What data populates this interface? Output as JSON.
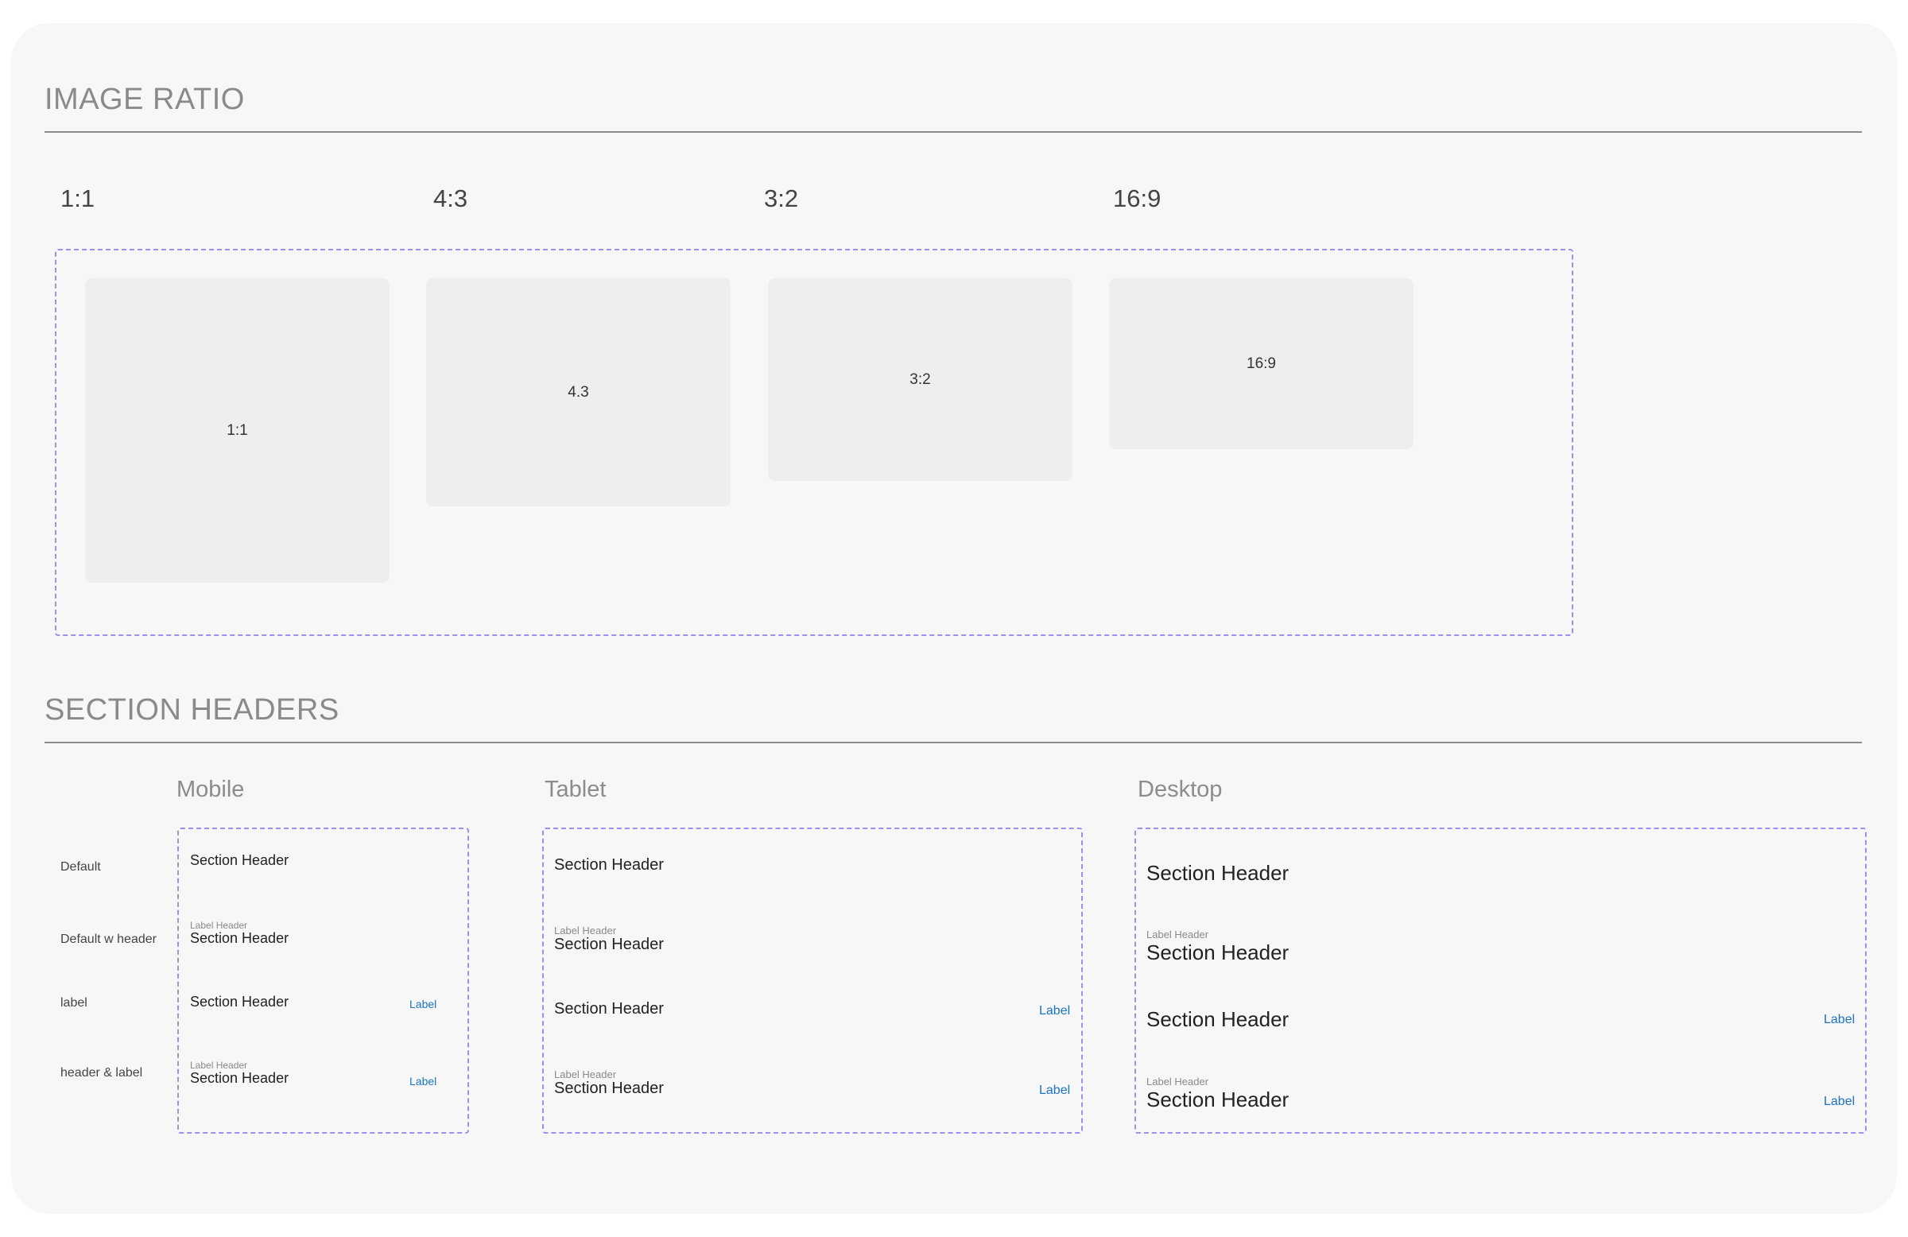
{
  "image_ratio": {
    "title": "IMAGE RATIO",
    "ratios": [
      {
        "heading": "1:1",
        "box_label": "1:1"
      },
      {
        "heading": "4:3",
        "box_label": "4.3"
      },
      {
        "heading": "3:2",
        "box_label": "3:2"
      },
      {
        "heading": "16:9",
        "box_label": "16:9"
      }
    ]
  },
  "section_headers": {
    "title": "SECTION HEADERS",
    "devices": [
      "Mobile",
      "Tablet",
      "Desktop"
    ],
    "rows": [
      "Default",
      "Default w header",
      "label",
      "header &  label"
    ],
    "sample": {
      "section_header": "Section Header",
      "label_header": "Label Header",
      "label": "Label"
    }
  }
}
